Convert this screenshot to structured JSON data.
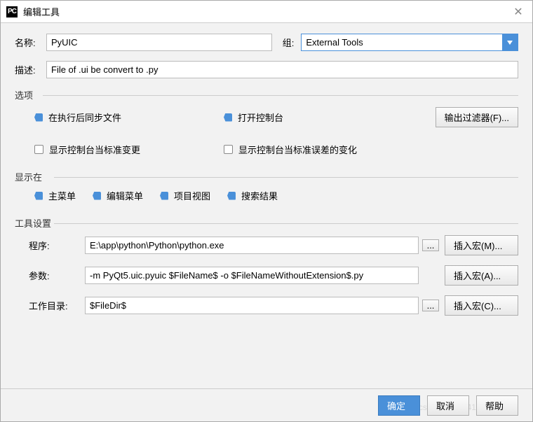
{
  "titlebar": {
    "title": "编辑工具"
  },
  "fields": {
    "name_label": "名称:",
    "name_value": "PyUIC",
    "group_label": "组:",
    "group_value": "External Tools",
    "desc_label": "描述:",
    "desc_value": "File of .ui be convert to .py"
  },
  "sections": {
    "options": "选项",
    "show_in": "显示在",
    "tool_settings": "工具设置"
  },
  "options": {
    "sync_files": "在执行后同步文件",
    "open_console": "打开控制台",
    "output_filter_btn": "输出过滤器(F)...",
    "show_stdout": "显示控制台当标准变更",
    "show_stderr": "显示控制台当标准误差的变化"
  },
  "show_in": {
    "main_menu": "主菜单",
    "edit_menu": "编辑菜单",
    "project_view": "项目视图",
    "search_results": "搜索结果"
  },
  "tool": {
    "program_label": "程序:",
    "program_value": "E:\\app\\python\\Python\\python.exe",
    "args_label": "参数:",
    "args_value": "-m PyQt5.uic.pyuic $FileName$ -o $FileNameWithoutExtension$.py",
    "workdir_label": "工作目录:",
    "workdir_value": "$FileDir$",
    "insert_macro_m": "插入宏(M)...",
    "insert_macro_a": "插入宏(A)...",
    "insert_macro_c": "插入宏(C)...",
    "ellipsis": "..."
  },
  "footer": {
    "ok": "确定",
    "cancel": "取消",
    "help": "帮助"
  },
  "watermark": "blog.csdn.net/qq_41291730"
}
